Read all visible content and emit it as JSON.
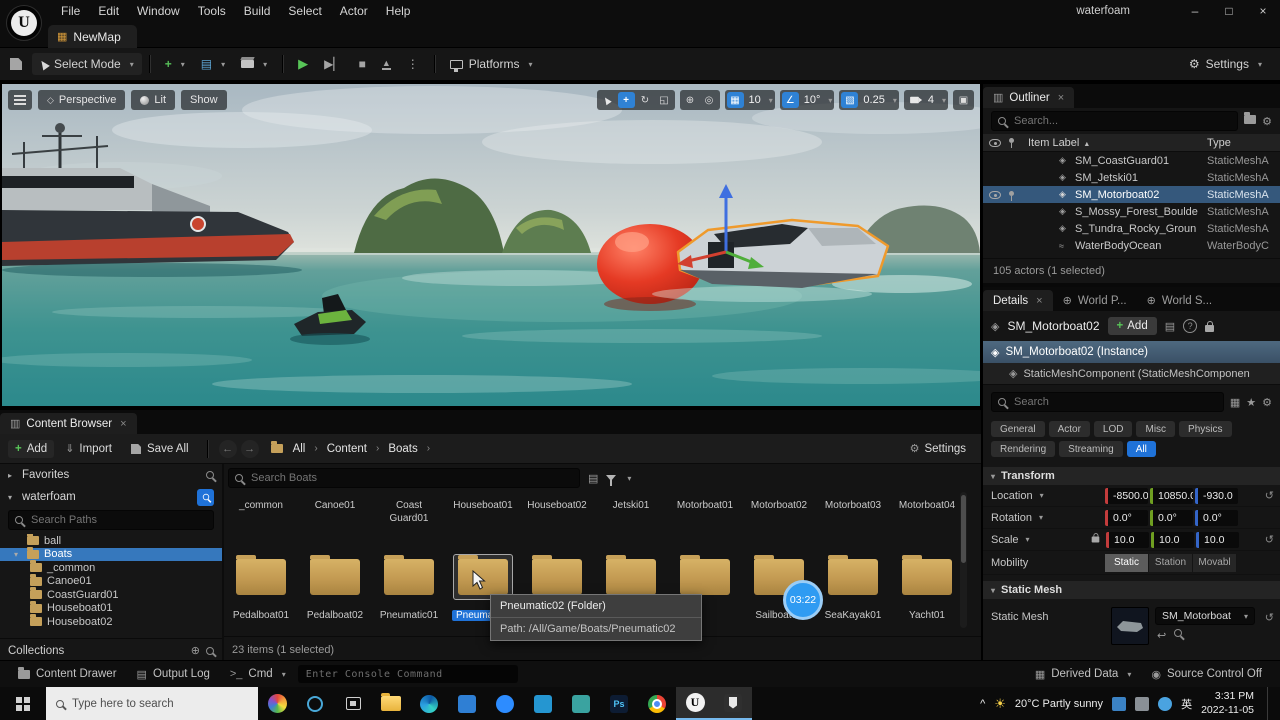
{
  "menubar": {
    "items": [
      "File",
      "Edit",
      "Window",
      "Tools",
      "Build",
      "Select",
      "Actor",
      "Help"
    ],
    "project_title": "waterfoam"
  },
  "tabbar": {
    "map_tab": "NewMap"
  },
  "toolbar": {
    "select_mode": "Select Mode",
    "platforms": "Platforms",
    "settings": "Settings"
  },
  "viewport": {
    "perspective": "Perspective",
    "lit": "Lit",
    "show": "Show",
    "snap_grid": "10",
    "snap_rotation": "10°",
    "snap_scale": "0.25",
    "camera_speed": "4"
  },
  "outliner": {
    "title": "Outliner",
    "search_placeholder": "Search...",
    "col_item_label": "Item Label",
    "col_type": "Type",
    "rows": [
      {
        "label": "SM_CoastGuard01",
        "type": "StaticMeshA"
      },
      {
        "label": "SM_Jetski01",
        "type": "StaticMeshA"
      },
      {
        "label": "SM_Motorboat02",
        "type": "StaticMeshA"
      },
      {
        "label": "S_Mossy_Forest_Boulde",
        "type": "StaticMeshA"
      },
      {
        "label": "S_Tundra_Rocky_Groun",
        "type": "StaticMeshA"
      },
      {
        "label": "WaterBodyOcean",
        "type": "WaterBodyC"
      }
    ],
    "status": "105 actors (1 selected)"
  },
  "details": {
    "tab_details": "Details",
    "tab_world_partition": "World P...",
    "tab_world_settings": "World S...",
    "object_name": "SM_Motorboat02",
    "add_button": "Add",
    "instance_label": "SM_Motorboat02 (Instance)",
    "component_label": "StaticMeshComponent (StaticMeshComponen",
    "search_placeholder": "Search",
    "filters": [
      "General",
      "Actor",
      "LOD",
      "Misc",
      "Physics",
      "Rendering",
      "Streaming",
      "All"
    ],
    "transform": {
      "section": "Transform",
      "location_label": "Location",
      "location_x": "-8500.0",
      "location_y": "10850.0",
      "location_z": "-930.0",
      "rotation_label": "Rotation",
      "rotation_x": "0.0°",
      "rotation_y": "0.0°",
      "rotation_z": "0.0°",
      "scale_label": "Scale",
      "scale_x": "10.0",
      "scale_y": "10.0",
      "scale_z": "10.0",
      "mobility_label": "Mobility",
      "mobility_static": "Static",
      "mobility_stationary": "Station",
      "mobility_movable": "Movabl"
    },
    "static_mesh": {
      "section": "Static Mesh",
      "label": "Static Mesh",
      "value": "SM_Motorboat"
    }
  },
  "content_browser": {
    "tab_title": "Content Browser",
    "add_button": "Add",
    "import_button": "Import",
    "save_all_button": "Save All",
    "breadcrumb": [
      "All",
      "Content",
      "Boats"
    ],
    "settings": "Settings",
    "search_placeholder": "Search Boats",
    "sidebar": {
      "favorites": "Favorites",
      "project_root": "waterfoam",
      "search_paths_placeholder": "Search Paths",
      "tree": [
        "ball",
        "Boats",
        "_common",
        "Canoe01",
        "CoastGuard01",
        "Houseboat01",
        "Houseboat02"
      ],
      "collections": "Collections"
    },
    "row1_labels": [
      "_common",
      "Canoe01",
      "Coast Guard01",
      "Houseboat01",
      "Houseboat02",
      "Jetski01",
      "Motorboat01",
      "Motorboat02",
      "Motorboat03",
      "Motorboat04"
    ],
    "row2_labels": [
      "Pedalboat01",
      "Pedalboat02",
      "Pneumatic01",
      "Pneumatic02",
      "",
      "",
      "",
      "Sailboat03",
      "SeaKayak01",
      "Yacht01"
    ],
    "tooltip": {
      "title": "Pneumatic02 (Folder)",
      "path": "Path: /All/Game/Boats/Pneumatic02"
    },
    "recording_timer": "03:22",
    "status": "23 items (1 selected)"
  },
  "statusbar": {
    "content_drawer": "Content Drawer",
    "output_log": "Output Log",
    "cmd": "Cmd",
    "console_placeholder": "Enter Console Command",
    "derived_data": "Derived Data",
    "source_control": "Source Control Off"
  },
  "taskbar": {
    "search_placeholder": "Type here to search",
    "weather": "20°C Partly sunny",
    "ime": "英",
    "time": "3:31 PM",
    "date": "2022-11-05"
  },
  "colors": {
    "accent_blue": "#1f72d8",
    "selection_blue": "#3678bd",
    "folder_yellow": "#c39a52",
    "axis_red": "#c33c3c",
    "axis_green": "#6f9f21",
    "axis_blue": "#3465c8",
    "play_green": "#58c558",
    "selection_outline_orange": "#ef9a2c"
  }
}
